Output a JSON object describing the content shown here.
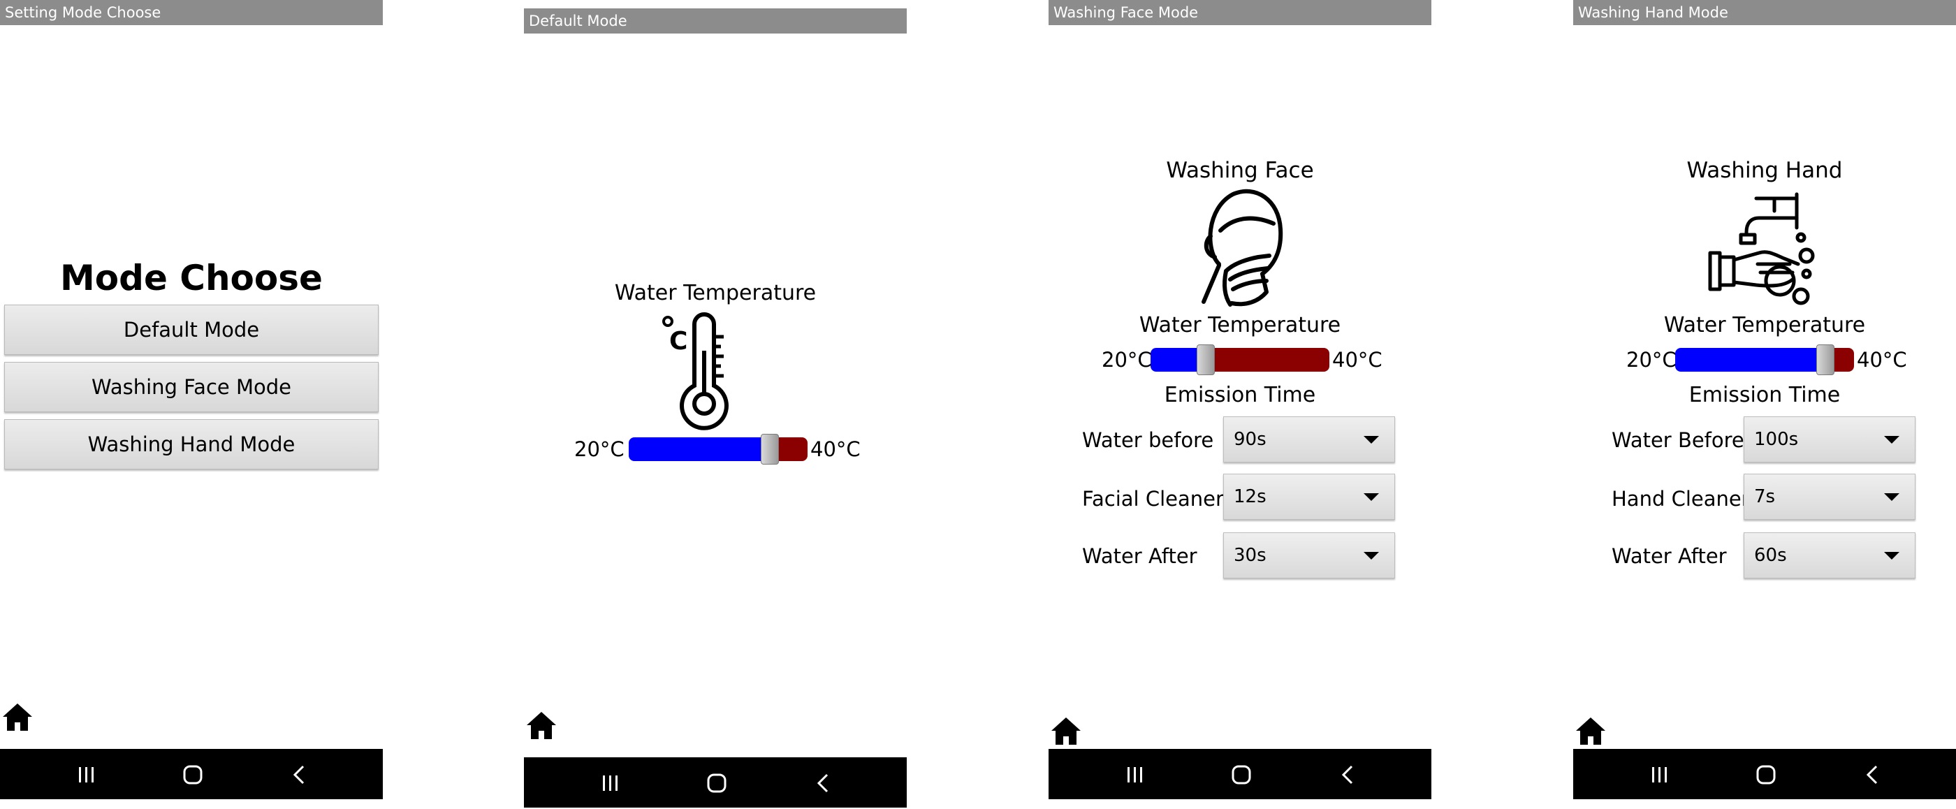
{
  "screens": {
    "mode_choose": {
      "title": "Setting Mode Choose",
      "heading": "Mode Choose",
      "buttons": [
        "Default Mode",
        "Washing Face Mode",
        "Washing Hand Mode"
      ]
    },
    "default_mode": {
      "title": "Default Mode",
      "heading": "Water Temperature",
      "temp_min": "20°C",
      "temp_max": "40°C",
      "temp_fraction": 0.79
    },
    "face_mode": {
      "title": "Washing Face Mode",
      "heading": "Washing Face",
      "water_temp_label": "Water Temperature",
      "temp_min": "20°C",
      "temp_max": "40°C",
      "temp_fraction": 0.31,
      "emission_label": "Emission Time",
      "rows": [
        {
          "label": "Water before",
          "value": "90s"
        },
        {
          "label": "Facial Cleaner",
          "value": "12s"
        },
        {
          "label": "Water After",
          "value": "30s"
        }
      ]
    },
    "hand_mode": {
      "title": "Washing Hand Mode",
      "heading": "Washing Hand",
      "water_temp_label": "Water Temperature",
      "temp_min": "20°C",
      "temp_max": "40°C",
      "temp_fraction": 0.84,
      "emission_label": "Emission Time",
      "rows": [
        {
          "label": "Water Before",
          "value": "100s"
        },
        {
          "label": "Hand Cleaner",
          "value": "7s"
        },
        {
          "label": "Water After",
          "value": "60s"
        }
      ]
    }
  },
  "icons": {
    "home": "home-icon",
    "recents": "recent-apps-icon",
    "nav_home": "nav-home-icon",
    "back": "back-icon",
    "thermometer": "thermometer-icon",
    "face": "washing-face-icon",
    "hand": "washing-hand-icon"
  },
  "colors": {
    "titlebar": "#8c8c8c",
    "slider_cold": "#0000ff",
    "slider_hot": "#8b0000",
    "navbar": "#000000"
  }
}
